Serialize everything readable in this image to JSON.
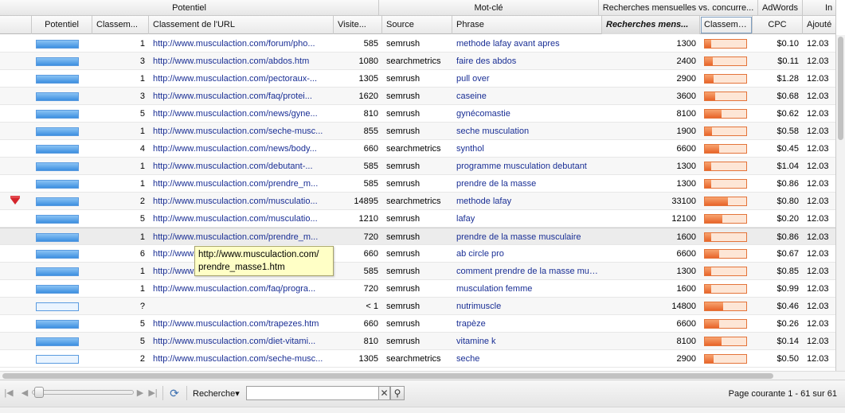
{
  "group_headers": [
    "Potentiel",
    "Mot-clé",
    "Recherches mensuelles vs. concurre...",
    "AdWords",
    "In"
  ],
  "columns": {
    "potentiel": "Potentiel",
    "classement": "Classem...",
    "url": "Classement de l'URL",
    "visites": "Visite...",
    "source": "Source",
    "phrase": "Phrase",
    "recherches": "Recherches mens...",
    "concurrence": "Classemen...",
    "cpc": "CPC",
    "ajoute": "Ajouté"
  },
  "rows": [
    {
      "flag": false,
      "potentiel": 1.0,
      "classement": "1",
      "url": "http://www.musculaction.com/forum/pho...",
      "visites": "585",
      "source": "semrush",
      "phrase": "methode lafay avant apres",
      "recherches": "1300",
      "concurrence": 0.15,
      "cpc": "$0.10",
      "ajoute": "12.03"
    },
    {
      "flag": false,
      "potentiel": 1.0,
      "classement": "3",
      "url": "http://www.musculaction.com/abdos.htm",
      "visites": "1080",
      "source": "searchmetrics",
      "phrase": "faire des abdos",
      "recherches": "2400",
      "concurrence": 0.2,
      "cpc": "$0.11",
      "ajoute": "12.03"
    },
    {
      "flag": false,
      "potentiel": 1.0,
      "classement": "1",
      "url": "http://www.musculaction.com/pectoraux-...",
      "visites": "1305",
      "source": "semrush",
      "phrase": "pull over",
      "recherches": "2900",
      "concurrence": 0.22,
      "cpc": "$1.28",
      "ajoute": "12.03"
    },
    {
      "flag": false,
      "potentiel": 1.0,
      "classement": "3",
      "url": "http://www.musculaction.com/faq/protei...",
      "visites": "1620",
      "source": "semrush",
      "phrase": "caseine",
      "recherches": "3600",
      "concurrence": 0.25,
      "cpc": "$0.68",
      "ajoute": "12.03"
    },
    {
      "flag": false,
      "potentiel": 1.0,
      "classement": "5",
      "url": "http://www.musculaction.com/news/gyne...",
      "visites": "810",
      "source": "semrush",
      "phrase": "gynécomastie",
      "recherches": "8100",
      "concurrence": 0.4,
      "cpc": "$0.62",
      "ajoute": "12.03"
    },
    {
      "flag": false,
      "potentiel": 1.0,
      "classement": "1",
      "url": "http://www.musculaction.com/seche-musc...",
      "visites": "855",
      "source": "semrush",
      "phrase": "seche musculation",
      "recherches": "1900",
      "concurrence": 0.18,
      "cpc": "$0.58",
      "ajoute": "12.03"
    },
    {
      "flag": false,
      "potentiel": 1.0,
      "classement": "4",
      "url": "http://www.musculaction.com/news/body...",
      "visites": "660",
      "source": "searchmetrics",
      "phrase": "synthol",
      "recherches": "6600",
      "concurrence": 0.35,
      "cpc": "$0.45",
      "ajoute": "12.03"
    },
    {
      "flag": false,
      "potentiel": 1.0,
      "classement": "1",
      "url": "http://www.musculaction.com/debutant-...",
      "visites": "585",
      "source": "semrush",
      "phrase": "programme musculation debutant",
      "recherches": "1300",
      "concurrence": 0.15,
      "cpc": "$1.04",
      "ajoute": "12.03"
    },
    {
      "flag": false,
      "potentiel": 1.0,
      "classement": "1",
      "url": "http://www.musculaction.com/prendre_m...",
      "visites": "585",
      "source": "semrush",
      "phrase": "prendre de la masse",
      "recherches": "1300",
      "concurrence": 0.15,
      "cpc": "$0.86",
      "ajoute": "12.03"
    },
    {
      "flag": true,
      "potentiel": 1.0,
      "classement": "2",
      "url": "http://www.musculaction.com/musculatio...",
      "visites": "14895",
      "source": "searchmetrics",
      "phrase": "methode lafay",
      "recherches": "33100",
      "concurrence": 0.55,
      "cpc": "$0.80",
      "ajoute": "12.03"
    },
    {
      "flag": false,
      "potentiel": 1.0,
      "classement": "5",
      "url": "http://www.musculaction.com/musculatio...",
      "visites": "1210",
      "source": "semrush",
      "phrase": "lafay",
      "recherches": "12100",
      "concurrence": 0.42,
      "cpc": "$0.20",
      "ajoute": "12.03"
    },
    {
      "flag": false,
      "potentiel": 1.0,
      "classement": "1",
      "url": "http://www.musculaction.com/prendre_m...",
      "visites": "720",
      "source": "semrush",
      "phrase": "prendre de la masse musculaire",
      "recherches": "1600",
      "concurrence": 0.16,
      "cpc": "$0.86",
      "ajoute": "12.03",
      "hover": true
    },
    {
      "flag": false,
      "potentiel": 1.0,
      "classement": "6",
      "url": "http://www.musculaction.com/",
      "visites": "660",
      "source": "semrush",
      "phrase": "ab circle pro",
      "recherches": "6600",
      "concurrence": 0.35,
      "cpc": "$0.67",
      "ajoute": "12.03"
    },
    {
      "flag": false,
      "potentiel": 1.0,
      "classement": "1",
      "url": "http://www.musculaction.com/prendre_m...",
      "visites": "585",
      "source": "semrush",
      "phrase": "comment prendre de la masse mus...",
      "recherches": "1300",
      "concurrence": 0.15,
      "cpc": "$0.85",
      "ajoute": "12.03"
    },
    {
      "flag": false,
      "potentiel": 1.0,
      "classement": "1",
      "url": "http://www.musculaction.com/faq/progra...",
      "visites": "720",
      "source": "semrush",
      "phrase": "musculation femme",
      "recherches": "1600",
      "concurrence": 0.16,
      "cpc": "$0.99",
      "ajoute": "12.03"
    },
    {
      "flag": false,
      "potentiel": 0.0,
      "classement": "?",
      "url": "",
      "visites": "< 1",
      "source": "semrush",
      "phrase": "nutrimuscle",
      "recherches": "14800",
      "concurrence": 0.45,
      "cpc": "$0.46",
      "ajoute": "12.03"
    },
    {
      "flag": false,
      "potentiel": 1.0,
      "classement": "5",
      "url": "http://www.musculaction.com/trapezes.htm",
      "visites": "660",
      "source": "semrush",
      "phrase": "trapèze",
      "recherches": "6600",
      "concurrence": 0.35,
      "cpc": "$0.26",
      "ajoute": "12.03"
    },
    {
      "flag": false,
      "potentiel": 1.0,
      "classement": "5",
      "url": "http://www.musculaction.com/diet-vitami...",
      "visites": "810",
      "source": "semrush",
      "phrase": "vitamine k",
      "recherches": "8100",
      "concurrence": 0.4,
      "cpc": "$0.14",
      "ajoute": "12.03"
    },
    {
      "flag": false,
      "potentiel": 0.0,
      "classement": "2",
      "url": "http://www.musculaction.com/seche-musc...",
      "visites": "1305",
      "source": "searchmetrics",
      "phrase": "seche",
      "recherches": "2900",
      "concurrence": 0.22,
      "cpc": "$0.50",
      "ajoute": "12.03"
    }
  ],
  "tooltip": {
    "line1": "http://www.musculaction.com/",
    "line2": "prendre_masse1.htm"
  },
  "toolbar": {
    "first_icon": "first-page-icon",
    "prev_icon": "prev-page-icon",
    "next_icon": "next-page-icon",
    "last_icon": "last-page-icon",
    "refresh_icon": "refresh-icon",
    "search_label": "Recherche",
    "search_value": "",
    "clear_label": "✕",
    "page_info": "Page courante 1 - 61 sur 61"
  },
  "colors": {
    "potentiel_bar": "#5a9be0",
    "competition_bar": "#e8652a",
    "link": "#1a2f95"
  }
}
